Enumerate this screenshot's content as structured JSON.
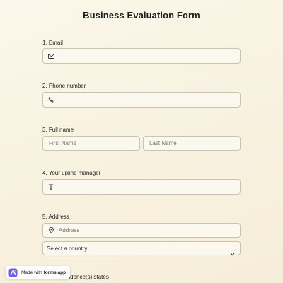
{
  "form": {
    "title": "Business Evaluation Form",
    "q1": {
      "label": "1.  Email",
      "icon": "envelope-icon"
    },
    "q2": {
      "label": "2. Phone number",
      "icon": "phone-icon"
    },
    "q3": {
      "label": "3. Full name",
      "first_placeholder": "First Name",
      "last_placeholder": "Last Name"
    },
    "q4": {
      "label": "4. Your upline manager",
      "icon": "text-T-icon"
    },
    "q5": {
      "label": "5. Address",
      "address_placeholder": "Address",
      "address_icon": "map-pin-icon",
      "country_select": "Select a country"
    },
    "q6": {
      "label": "6. Non-residence(s) states"
    }
  },
  "badge": {
    "made_with": "Made with",
    "brand": "forms.app"
  },
  "colors": {
    "background": "#fbf7ea",
    "field_border": "#c9c4ac",
    "field_bg": "#fbf9ef",
    "badge_logo": "#6b5cf0"
  }
}
